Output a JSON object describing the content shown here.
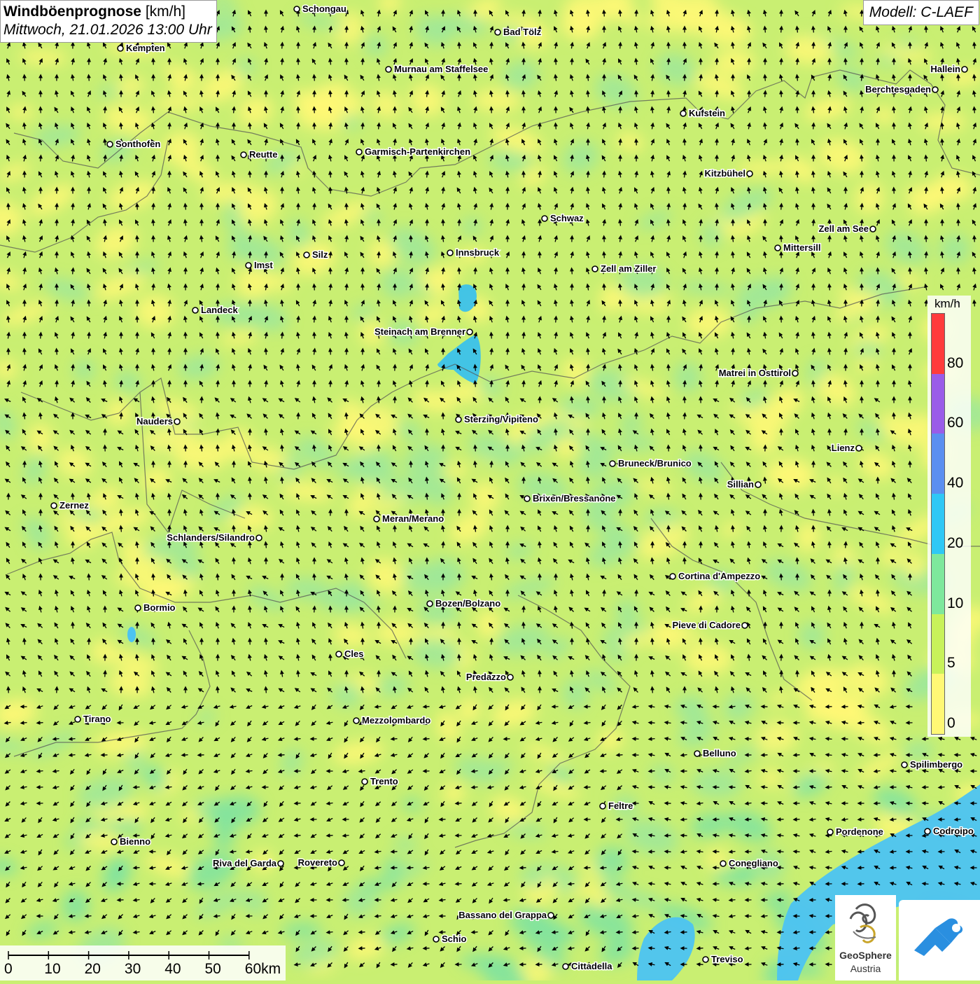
{
  "title": {
    "main": "Windböenprognose",
    "unit": "[km/h]",
    "date": "Mittwoch, 21.01.2026 13:00 Uhr"
  },
  "model": "Modell: C-LAEF",
  "legend": {
    "unit": "km/h",
    "labels": [
      "80",
      "60",
      "40",
      "20",
      "10",
      "5",
      "0"
    ],
    "colors": [
      "#ff3b3b",
      "#9a5ce8",
      "#5b8ff0",
      "#2fc8f5",
      "#7ee89c",
      "#c8f25a",
      "#fff875"
    ]
  },
  "scale": {
    "labels": [
      "0",
      "10",
      "20",
      "30",
      "40",
      "50",
      "60km"
    ]
  },
  "logos": {
    "geosphere_line1": "GeoSphere",
    "geosphere_line2": "Austria"
  },
  "cities": [
    {
      "name": "Schongau"
    },
    {
      "name": "Bad Tölz"
    },
    {
      "name": "Kempten"
    },
    {
      "name": "Murnau am Staffelsee"
    },
    {
      "name": "Hallein"
    },
    {
      "name": "Berchtesgaden"
    },
    {
      "name": "Kufstein"
    },
    {
      "name": "Sonthofen"
    },
    {
      "name": "Reutte"
    },
    {
      "name": "Garmisch-Partenkirchen"
    },
    {
      "name": "Kitzbühel"
    },
    {
      "name": "Schwaz"
    },
    {
      "name": "Zell am See"
    },
    {
      "name": "Innsbruck"
    },
    {
      "name": "Mittersill"
    },
    {
      "name": "Silz"
    },
    {
      "name": "Imst"
    },
    {
      "name": "Zell am Ziller"
    },
    {
      "name": "Landeck"
    },
    {
      "name": "Steinach am Brenner"
    },
    {
      "name": "Matrei in Osttirol"
    },
    {
      "name": "Nauders"
    },
    {
      "name": "Sterzing/Vipiteno"
    },
    {
      "name": "Lienz"
    },
    {
      "name": "Bruneck/Brunico"
    },
    {
      "name": "Sillian"
    },
    {
      "name": "Brixen/Bressanone"
    },
    {
      "name": "Zernez"
    },
    {
      "name": "Meran/Merano"
    },
    {
      "name": "Schlanders/Silandro"
    },
    {
      "name": "Cortina d'Ampezzo"
    },
    {
      "name": "Bozen/Bolzano"
    },
    {
      "name": "Bormio"
    },
    {
      "name": "Pieve di Cadore"
    },
    {
      "name": "Cles"
    },
    {
      "name": "Predazzo"
    },
    {
      "name": "Tirano"
    },
    {
      "name": "Mezzolombardo"
    },
    {
      "name": "Belluno"
    },
    {
      "name": "Spilimbergo"
    },
    {
      "name": "Trento"
    },
    {
      "name": "Feltre"
    },
    {
      "name": "Pordenone"
    },
    {
      "name": "Codroipo"
    },
    {
      "name": "Bienno"
    },
    {
      "name": "Riva del Garda"
    },
    {
      "name": "Rovereto"
    },
    {
      "name": "Conegliano"
    },
    {
      "name": "Bassano del Grappa"
    },
    {
      "name": "Schio"
    },
    {
      "name": "Treviso"
    },
    {
      "name": "Cittadella"
    }
  ]
}
